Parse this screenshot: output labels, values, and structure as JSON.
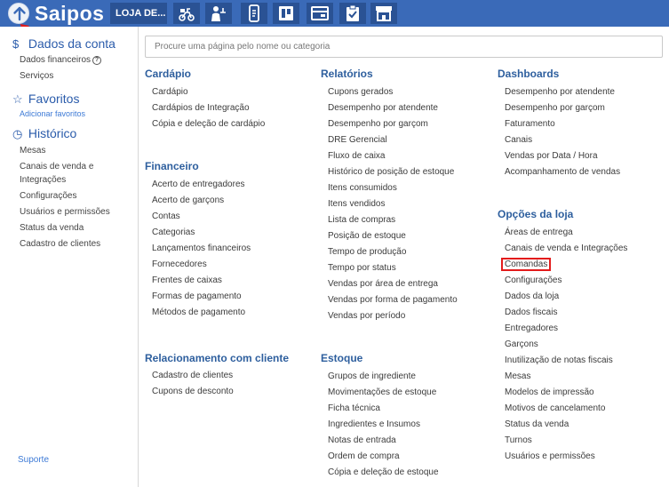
{
  "topbar": {
    "brand": "Saipos",
    "store_button": "LOJA DE...",
    "icons": [
      "delivery-motorcycle-icon",
      "waiter-icon",
      "phone-order-icon",
      "kanban-board-icon",
      "cashier-icon",
      "clipboard-check-icon",
      "storefront-icon"
    ]
  },
  "sidebar": {
    "account": {
      "title": "Dados da conta",
      "items": [
        "Dados financeiros",
        "Serviços"
      ]
    },
    "favorites": {
      "title": "Favoritos",
      "add_link": "Adicionar favoritos"
    },
    "history": {
      "title": "Histórico",
      "items": [
        "Mesas",
        "Canais de venda e",
        "Integrações",
        "Configurações",
        "Usuários e permissões",
        "Status da venda",
        "Cadastro de clientes"
      ]
    },
    "support": "Suporte"
  },
  "search": {
    "placeholder": "Procure uma página pelo nome ou categoria"
  },
  "columns": {
    "c1": {
      "cardapio": {
        "title": "Cardápio",
        "items": [
          "Cardápio",
          "Cardápios de Integração",
          "Cópia e deleção de cardápio"
        ]
      },
      "financeiro": {
        "title": "Financeiro",
        "items": [
          "Acerto de entregadores",
          "Acerto de garçons",
          "Contas",
          "Categorias",
          "Lançamentos financeiros",
          "Fornecedores",
          "Frentes de caixas",
          "Formas de pagamento",
          "Métodos de pagamento"
        ]
      },
      "relacionamento": {
        "title": "Relacionamento com cliente",
        "items": [
          "Cadastro de clientes",
          "Cupons de desconto"
        ]
      }
    },
    "c2": {
      "relatorios": {
        "title": "Relatórios",
        "items": [
          "Cupons gerados",
          "Desempenho por atendente",
          "Desempenho por garçom",
          "DRE Gerencial",
          "Fluxo de caixa",
          "Histórico de posição de estoque",
          "Itens consumidos",
          "Itens vendidos",
          "Lista de compras",
          "Posição de estoque",
          "Tempo de produção",
          "Tempo por status",
          "Vendas por área de entrega",
          "Vendas por forma de pagamento",
          "Vendas por período"
        ]
      },
      "estoque": {
        "title": "Estoque",
        "items": [
          "Grupos de ingrediente",
          "Movimentações de estoque",
          "Ficha técnica",
          "Ingredientes e Insumos",
          "Notas de entrada",
          "Ordem de compra",
          "Cópia e deleção de estoque"
        ]
      }
    },
    "c3": {
      "dashboards": {
        "title": "Dashboards",
        "items": [
          "Desempenho por atendente",
          "Desempenho por garçom",
          "Faturamento",
          "Canais",
          "Vendas por Data / Hora",
          "Acompanhamento de vendas"
        ]
      },
      "opcoes": {
        "title": "Opções da loja",
        "items": [
          "Áreas de entrega",
          "Canais de venda e Integrações",
          "Comandas",
          "Configurações",
          "Dados da loja",
          "Dados fiscais",
          "Entregadores",
          "Garçons",
          "Inutilização de notas fiscais",
          "Mesas",
          "Modelos de impressão",
          "Motivos de cancelamento",
          "Status da venda",
          "Turnos",
          "Usuários e permissões"
        ]
      }
    }
  },
  "colors": {
    "topbar": "#3a6ab8",
    "category": "#2e5f9e",
    "highlight": "#e31b1b"
  }
}
